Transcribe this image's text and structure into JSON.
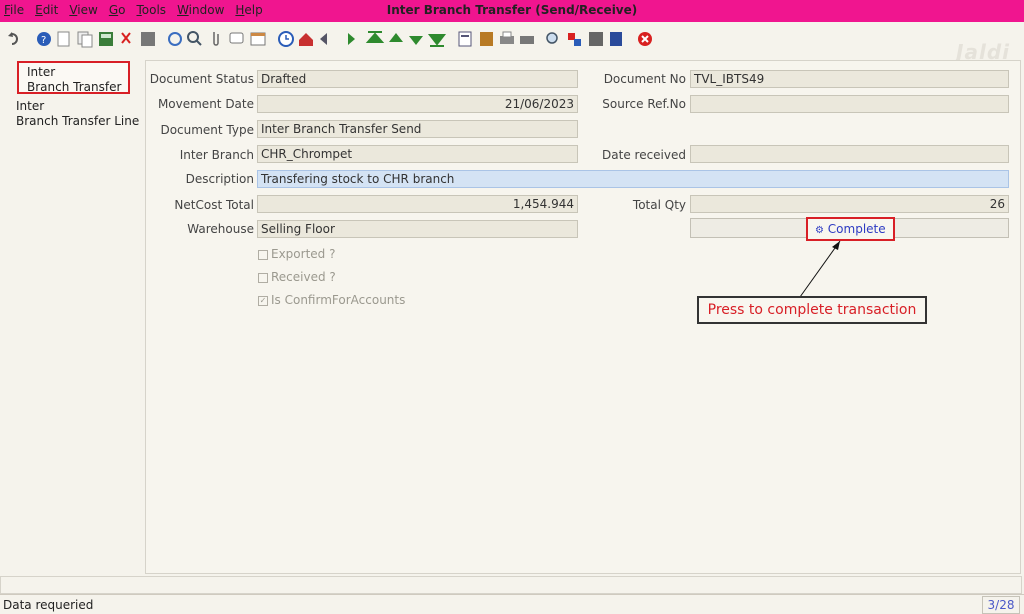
{
  "window": {
    "title": "Inter Branch Transfer (Send/Receive)"
  },
  "menu": [
    "File",
    "Edit",
    "View",
    "Go",
    "Tools",
    "Window",
    "Help"
  ],
  "toolbar_icons": [
    "undo-icon",
    "help-icon",
    "new-icon",
    "copy-icon",
    "save-icon",
    "delete-icon",
    "save-disk-icon",
    "refresh-icon",
    "find-icon",
    "attach-icon",
    "chat-icon",
    "calendar-icon",
    "history-icon",
    "home-icon",
    "back-icon",
    "forward-icon",
    "first-record-icon",
    "previous-record-icon",
    "next-record-icon",
    "last-record-icon",
    "report-icon",
    "archive-icon",
    "print-preview-icon",
    "print-icon",
    "zoom-across-icon",
    "request-icon",
    "product-info-icon",
    "workflow-icon",
    "end-icon"
  ],
  "logo": "Jaldi",
  "nav": {
    "items": [
      {
        "label_line1": "Inter",
        "label_line2": "Branch Transfer"
      },
      {
        "label_line1": "Inter",
        "label_line2": "Branch Transfer Line"
      }
    ]
  },
  "form": {
    "document_status": {
      "label": "Document Status",
      "value": "Drafted"
    },
    "document_no": {
      "label": "Document No",
      "value": "TVL_IBTS49"
    },
    "movement_date": {
      "label": "Movement Date",
      "value": "21/06/2023"
    },
    "source_ref_no": {
      "label": "Source Ref.No",
      "value": ""
    },
    "document_type": {
      "label": "Document Type",
      "value": "Inter Branch Transfer Send"
    },
    "inter_branch": {
      "label": "Inter Branch",
      "value": "CHR_Chrompet"
    },
    "date_received": {
      "label": "Date received",
      "value": ""
    },
    "description": {
      "label": "Description",
      "value": "Transfering stock to CHR branch"
    },
    "netcost_total": {
      "label": "NetCost Total",
      "value": "1,454.944"
    },
    "total_qty": {
      "label": "Total Qty",
      "value": "26"
    },
    "warehouse": {
      "label": "Warehouse",
      "value": "Selling Floor"
    },
    "exported": {
      "label": "Exported ?",
      "checked": false
    },
    "received": {
      "label": "Received ?",
      "checked": false
    },
    "is_confirm_for_accounts": {
      "label": "Is ConfirmForAccounts",
      "checked": true
    },
    "complete_button": {
      "label": "Complete"
    }
  },
  "callout": {
    "text": "Press to complete transaction"
  },
  "status": {
    "message": "Data requeried",
    "page": "3/28"
  },
  "colors": {
    "titlebar": "#f0158f",
    "highlight_border": "#d81f26",
    "focus_field": "#d4e3f4",
    "link": "#2e3bc2"
  }
}
